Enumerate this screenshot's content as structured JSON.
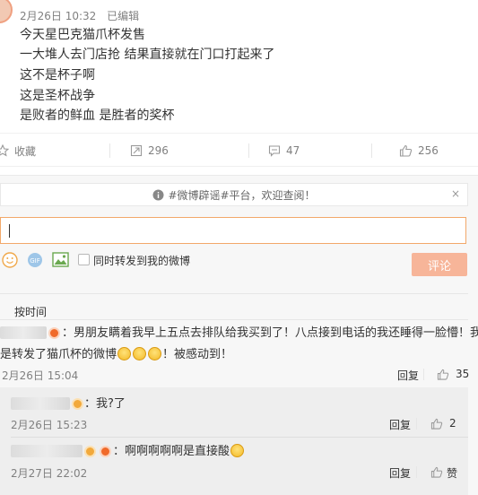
{
  "post": {
    "date": "2月26日 10:32",
    "edited": "已编辑",
    "lines": [
      "今天星巴克猫爪杯发售",
      "一大堆人去门店抢 结果直接就在门口打起来了",
      "这不是杯子啊",
      "这是圣杯战争",
      "是败者的鲜血 是胜者的奖杯"
    ]
  },
  "actions": {
    "favorite": "收藏",
    "repost_count": "296",
    "comment_count": "47",
    "like_count": "256"
  },
  "composer": {
    "notice": "#微博辟谣#平台，欢迎查阅！",
    "notice_close": "×",
    "input_value": "",
    "repost_checkbox_label": "同时转发到我的微博",
    "submit_label": "评论",
    "icons": [
      "smiley-icon",
      "gif-icon",
      "image-icon"
    ]
  },
  "sort": {
    "label": "按时间"
  },
  "comments": [
    {
      "text_line1": "：男朋友瞒着我早上五点去排队给我买到了！八点接到电话的我还睡得一脸懵！我只",
      "text_line2_pre": "是转发了猫爪杯的微博",
      "text_line2_post": "！被感动到！",
      "time": "2月26日 15:04",
      "reply_label": "回复",
      "likes": "35"
    },
    {
      "text": "：我?了",
      "time": "2月26日 15:23",
      "reply_label": "回复",
      "likes": "2"
    },
    {
      "text": "：啊啊啊啊啊是直接酸",
      "time": "2月27日 22:02",
      "reply_label": "回复",
      "likes": "赞"
    }
  ],
  "colors": {
    "accent_orange": "#f2a86a",
    "submit_bg": "#f7b599",
    "muted_text": "#808080"
  }
}
